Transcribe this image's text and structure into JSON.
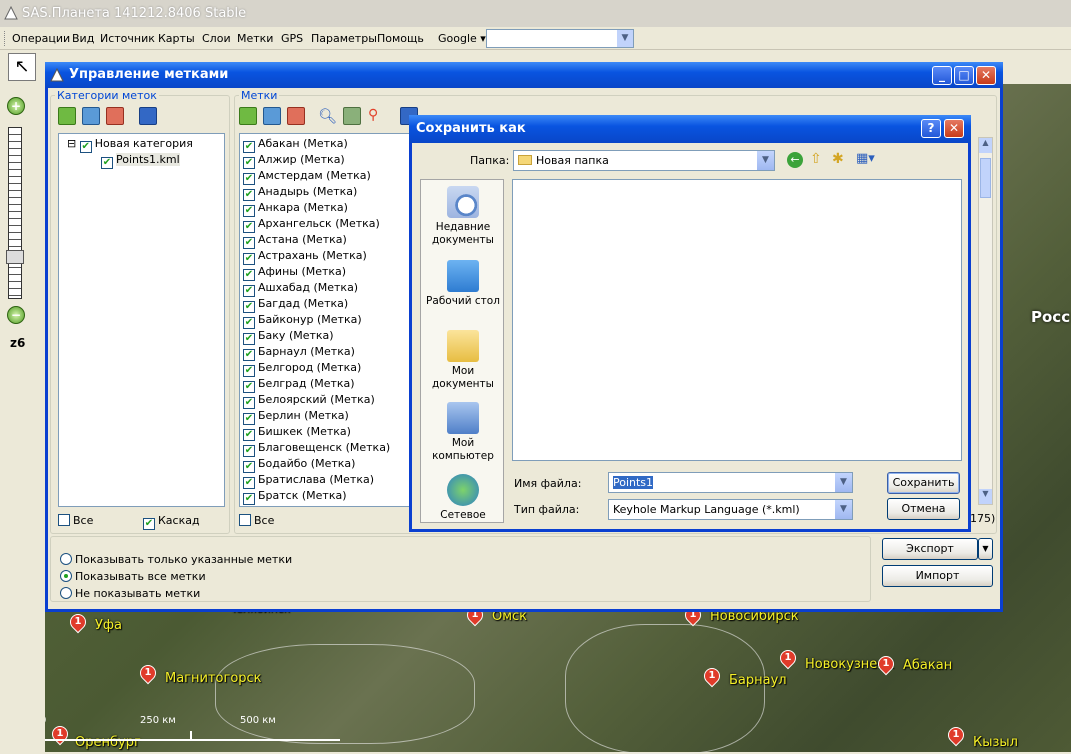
{
  "app": {
    "title": "SAS.Планета 141212.8406 Stable"
  },
  "menu": [
    "Операции",
    "Вид",
    "Источник",
    "Карты",
    "Слои",
    "Метки",
    "GPS",
    "Параметры",
    "Помощь"
  ],
  "search": {
    "provider": "Google",
    "value": ""
  },
  "map": {
    "zoom_label": "z6",
    "country_label": "Росс",
    "scale": [
      "0",
      "250 км",
      "500 км"
    ],
    "cities": [
      "Уфа",
      "Омск",
      "Новосибирск",
      "Магнитогорск",
      "Барнаул",
      "Новокузнецк",
      "Абакан",
      "Оренбург",
      "Кызыл",
      "Челябинск"
    ]
  },
  "marks_dialog": {
    "title": "Управление метками",
    "categories_label": "Категории меток",
    "marks_label": "Метки",
    "tree": {
      "category": "Новая категория",
      "file": "Points1.kml"
    },
    "marks": [
      "Абакан (Метка)",
      "Алжир (Метка)",
      "Амстердам (Метка)",
      "Анадырь (Метка)",
      "Анкара (Метка)",
      "Архангельск (Метка)",
      "Астана (Метка)",
      "Астрахань (Метка)",
      "Афины (Метка)",
      "Ашхабад (Метка)",
      "Багдад (Метка)",
      "Байконур (Метка)",
      "Баку (Метка)",
      "Барнаул (Метка)",
      "Белгород (Метка)",
      "Белград (Метка)",
      "Белоярский (Метка)",
      "Берлин (Метка)",
      "Бишкек (Метка)",
      "Благовещенск (Метка)",
      "Бодайбо (Метка)",
      "Братислава (Метка)",
      "Братск (Метка)"
    ],
    "all_cat": "Все",
    "cascade": "Каскад",
    "all_marks": "Все",
    "count": "175)",
    "radios": [
      "Показывать только указанные метки",
      "Показывать все метки",
      "Не показывать метки"
    ],
    "export": "Экспорт",
    "import": "Импорт"
  },
  "save_dialog": {
    "title": "Сохранить как",
    "folder_label": "Папка:",
    "folder_value": "Новая папка",
    "places": [
      "Недавние документы",
      "Рабочий стол",
      "Мои документы",
      "Мой компьютер",
      "Сетевое"
    ],
    "filename_label": "Имя файла:",
    "filename_value": "Points1",
    "filetype_label": "Тип файла:",
    "filetype_value": "Keyhole Markup Language (*.kml)",
    "save": "Сохранить",
    "cancel": "Отмена"
  }
}
